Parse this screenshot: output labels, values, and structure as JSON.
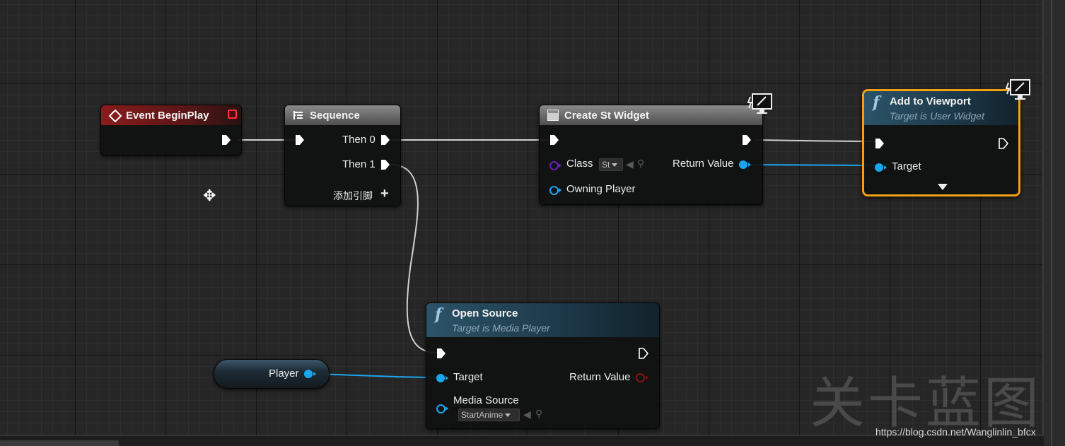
{
  "nodes": {
    "event_begin_play": {
      "title": "Event BeginPlay"
    },
    "sequence": {
      "title": "Sequence",
      "then0": "Then 0",
      "then1": "Then 1",
      "add_pin": "添加引脚"
    },
    "create_widget": {
      "title": "Create St Widget",
      "class_label": "Class",
      "class_value": "St",
      "owning_player": "Owning Player",
      "return_value": "Return Value"
    },
    "add_to_viewport": {
      "title": "Add to Viewport",
      "subtitle": "Target is User Widget",
      "target": "Target"
    },
    "open_source": {
      "title": "Open Source",
      "subtitle": "Target is Media Player",
      "target": "Target",
      "return_value": "Return Value",
      "media_source": "Media Source",
      "media_source_value": "StartAnime"
    },
    "player_var": {
      "label": "Player"
    }
  },
  "watermark": "关卡蓝图",
  "credit": "https://blog.csdn.net/Wanglinlin_bfcx",
  "colors": {
    "exec_wire": "#cfcfcf",
    "object_wire": "#1aa6ee",
    "event_header": "#8a1c1c",
    "function_header": "#2c5368",
    "selected_outline": "#f0a010"
  }
}
